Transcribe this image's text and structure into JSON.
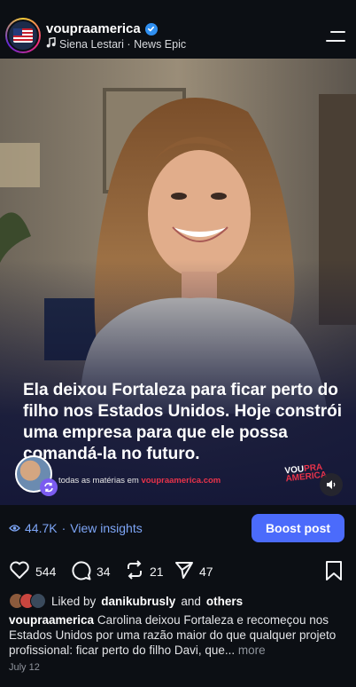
{
  "header": {
    "username": "voupraamerica",
    "audio": "Siena Lestari · News Epic"
  },
  "post": {
    "caption_overlay": "Ela deixou Fortaleza para ficar perto do filho nos Estados Unidos. Hoje constrói uma empresa para que ele possa comandá-la no futuro.",
    "footer_prefix": "todas as matérias em",
    "footer_link": "voupraamerica.com",
    "logo_line1": "VOU",
    "logo_line2": "PRA",
    "logo_line3": "AMERICA"
  },
  "insights": {
    "views": "44.7K",
    "view_insights": "View insights",
    "boost_label": "Boost post"
  },
  "actions": {
    "likes": "544",
    "comments": "34",
    "reposts": "21",
    "shares": "47"
  },
  "likes_line": {
    "prefix": "Liked by",
    "user": "danikubrusly",
    "and": "and",
    "others": "others"
  },
  "description": {
    "username": "voupraamerica",
    "text": "Carolina deixou Fortaleza e recomeçou nos Estados Unidos por uma razão maior do que qualquer projeto profissional: ficar perto do filho Davi, que...",
    "more": "more"
  },
  "date": "July 12",
  "colors": {
    "accent_blue": "#4b6bfb",
    "link_blue": "#7ea6f7",
    "brand_red": "#e8334a",
    "background": "#0c0f14"
  }
}
